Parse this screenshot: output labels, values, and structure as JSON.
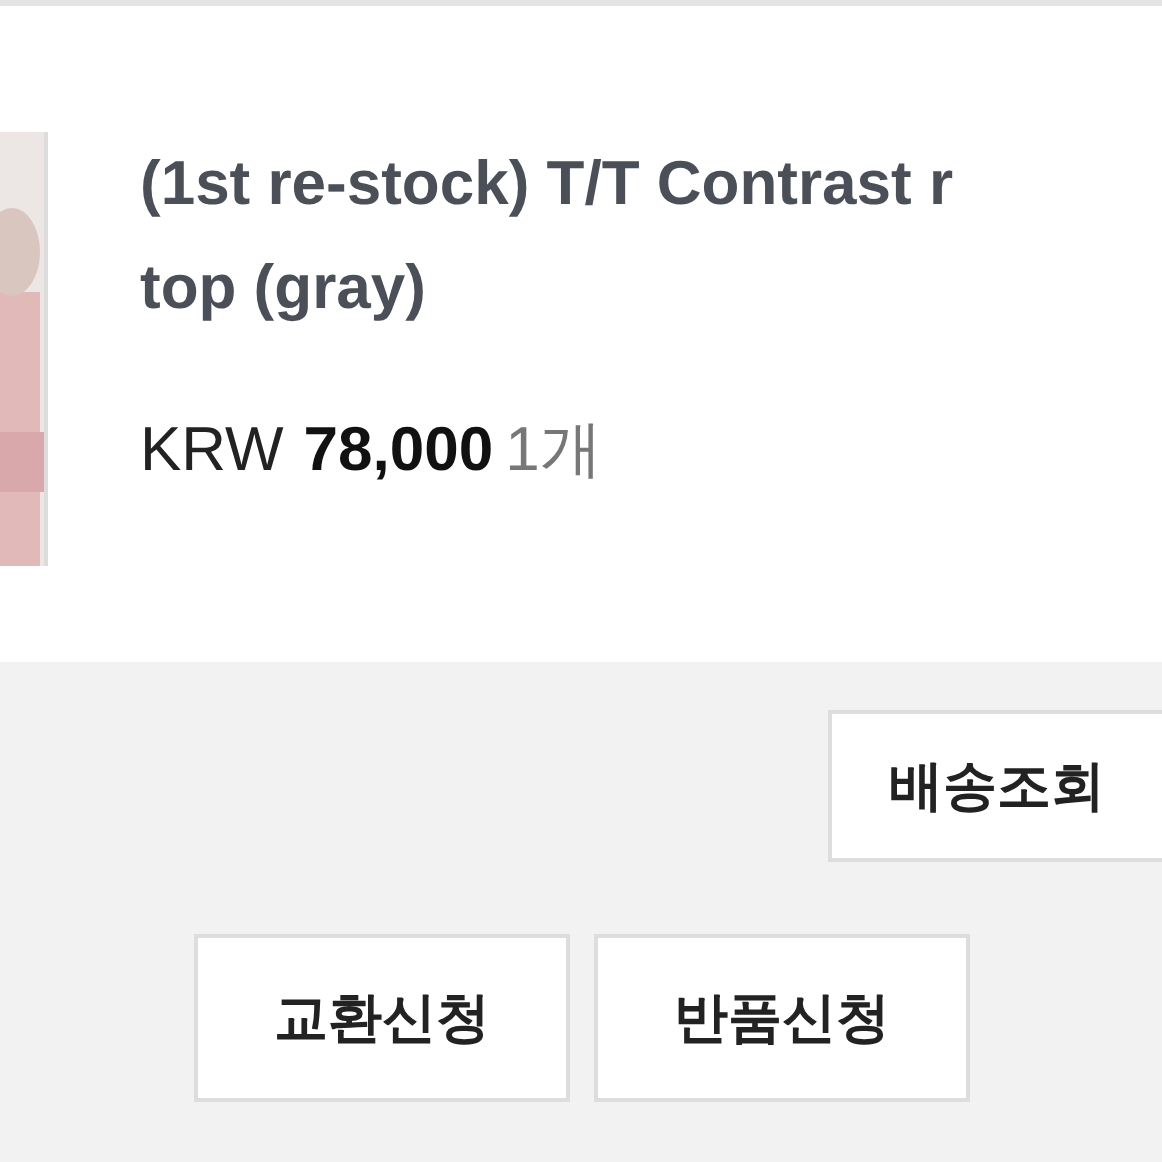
{
  "order_item": {
    "title_lines": [
      "(1st re-stock) T/T Contrast r",
      "top (gray)"
    ],
    "currency": "KRW",
    "price": "78,000",
    "quantity": "1개"
  },
  "tracking_button": {
    "label": "배송조회"
  },
  "request_buttons": [
    {
      "label": "교환신청"
    },
    {
      "label": "반품신청"
    }
  ]
}
